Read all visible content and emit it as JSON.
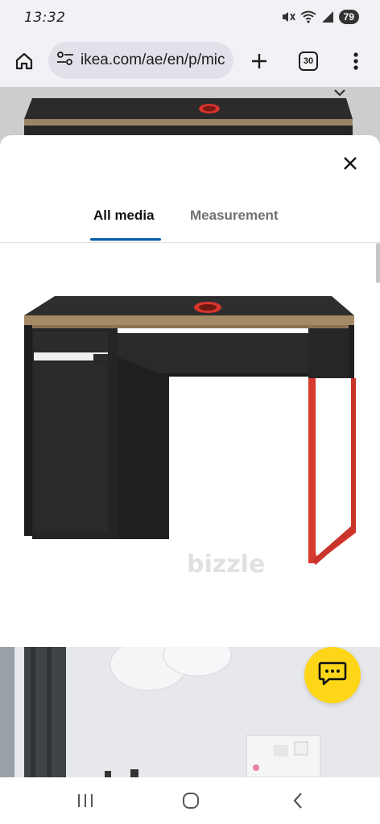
{
  "status_bar": {
    "time": "13:32",
    "battery": "79",
    "icons": [
      "mute-icon",
      "wifi-icon",
      "signal-icon",
      "battery-icon"
    ]
  },
  "browser": {
    "url": "ikea.com/ae/en/p/mic",
    "tab_count": "30",
    "icons": [
      "home-icon",
      "site-settings-icon",
      "new-tab-icon",
      "tabs-icon",
      "more-menu-icon"
    ]
  },
  "modal": {
    "tabs": [
      {
        "label": "All media",
        "active": true
      },
      {
        "label": "Measurement",
        "active": false
      }
    ],
    "watermark": "bizzle",
    "close_icon": "close-icon"
  },
  "chat_button": {
    "icon": "chat-icon",
    "color": "#fdd618"
  },
  "accent_color": "#0058a3",
  "nav_bar": {
    "icons": [
      "recent-apps-icon",
      "home-nav-icon",
      "back-icon"
    ]
  }
}
